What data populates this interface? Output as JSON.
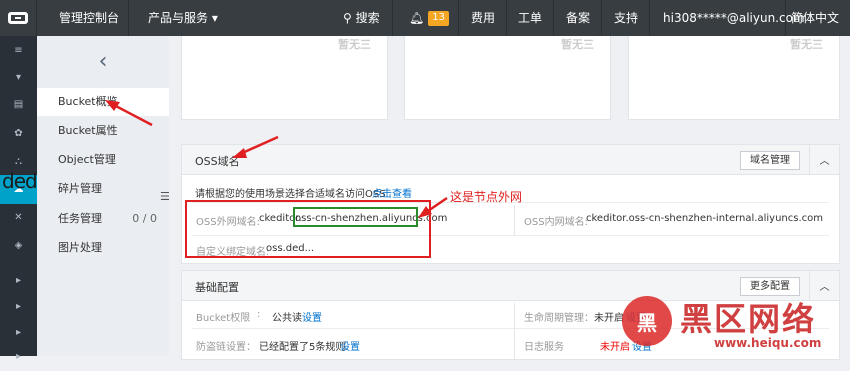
{
  "topbar": {
    "console": "管理控制台",
    "products": "产品与服务 ▾",
    "search": "搜索",
    "notify_count": "13",
    "fees": "费用",
    "tickets": "工单",
    "record": "备案",
    "support": "支持",
    "user": "hi308*****@aliyun.com",
    "language": "简体中文"
  },
  "sidebar": {
    "back_icon": "chevron-left-icon",
    "items": [
      {
        "label": "Bucket概览"
      },
      {
        "label": "Bucket属性"
      },
      {
        "label": "Object管理"
      },
      {
        "label": "碎片管理"
      },
      {
        "label": "任务管理",
        "count": "0 / 0"
      },
      {
        "label": "图片处理"
      }
    ],
    "overlay_text": "dede"
  },
  "cards": [
    {
      "watermark": "暂无三"
    },
    {
      "watermark": "暂无三"
    },
    {
      "watermark": "暂无三"
    }
  ],
  "oss_domain": {
    "title": "OSS域名",
    "manage_button": "域名管理",
    "hint": "请根据您的使用场景选择合适域名访问OSS",
    "hint_link": "点击查看",
    "external_label": "OSS外网域名:",
    "external_prefix": "ckeditor.",
    "external_value": "oss-cn-shenzhen.aliyuncs.com",
    "internal_label": "OSS内网域名:",
    "internal_value": "ckeditor.oss-cn-shenzhen-internal.aliyuncs.com",
    "custom_label": "自定义绑定域名:",
    "custom_value": "oss.ded..."
  },
  "basic_config": {
    "title": "基础配置",
    "more_button": "更多配置",
    "bucket_perm_label": "Bucket权限",
    "bucket_perm_value": "公共读",
    "bucket_perm_link": "设置",
    "lifecycle_label": "生命周期管理：",
    "lifecycle_value": "未开启",
    "lifecycle_link": "设置",
    "hotlink_label": "防盗链设置：",
    "hotlink_value": "已经配置了5条规则",
    "hotlink_link": "设置",
    "log_label": "日志服务",
    "log_value": "未开启",
    "log_link": "设置"
  },
  "annotation": {
    "text": "这是节点外网"
  },
  "watermark": {
    "circle": "黑",
    "brand": "黑区网络",
    "site": "www.heiqu.com"
  },
  "colors": {
    "topbar": "#373d41",
    "leftbar": "#293038",
    "accent": "#00a2ca",
    "annotation": "#e02020",
    "highlight": "#2a8a2a",
    "link": "#0070cc"
  }
}
